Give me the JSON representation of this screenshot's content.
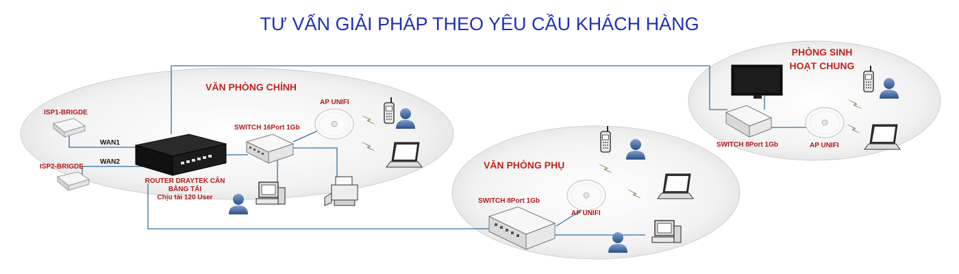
{
  "title": "TƯ VẤN GIẢI PHÁP THEO YÊU CẦU KHÁCH HÀNG",
  "zones": {
    "main_office": "VĂN PHÒNG CHÍNH",
    "branch_office": "VĂN PHÒNG PHỤ",
    "common_room_line1": "PHÒNG SINH",
    "common_room_line2": "HOẠT CHUNG"
  },
  "devices": {
    "isp1": "ISP1-BRIGDE",
    "isp2": "ISP2-BRIGDE",
    "wan1": "WAN1",
    "wan2": "WAN2",
    "router_line1": "ROUTER DRAYTEK CÂN",
    "router_line2": "BẰNG TẢI",
    "router_line3": "Chịu tải 120 User",
    "switch_main": "SWITCH 16Port 1Gb",
    "ap_main": "AP UNIFI",
    "switch_branch": "SWITCH 8Port 1Gb",
    "ap_branch": "AP UNIFI",
    "switch_common": "SWITCH 8Port 1Gb",
    "ap_common": "AP UNIFI"
  },
  "colors": {
    "title": "#1f2fb5",
    "zone_label": "#c0241c",
    "link": "#2f6fa8",
    "wireless": "#f2e600",
    "zone_fill": "#e9e9e9",
    "person": "#4a6fa5"
  }
}
